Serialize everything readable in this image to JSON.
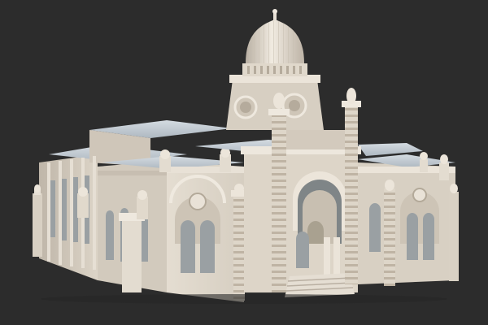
{
  "scene": {
    "subject": "building-render",
    "colors": {
      "background": "#2c2c2c",
      "stone": "#ddd5c8",
      "stone_light": "#eae3d8",
      "shade": "#b9afa2",
      "roof": "#c7d0d8",
      "window": "#9aa0a3",
      "stripe": "#c9bba8"
    }
  }
}
